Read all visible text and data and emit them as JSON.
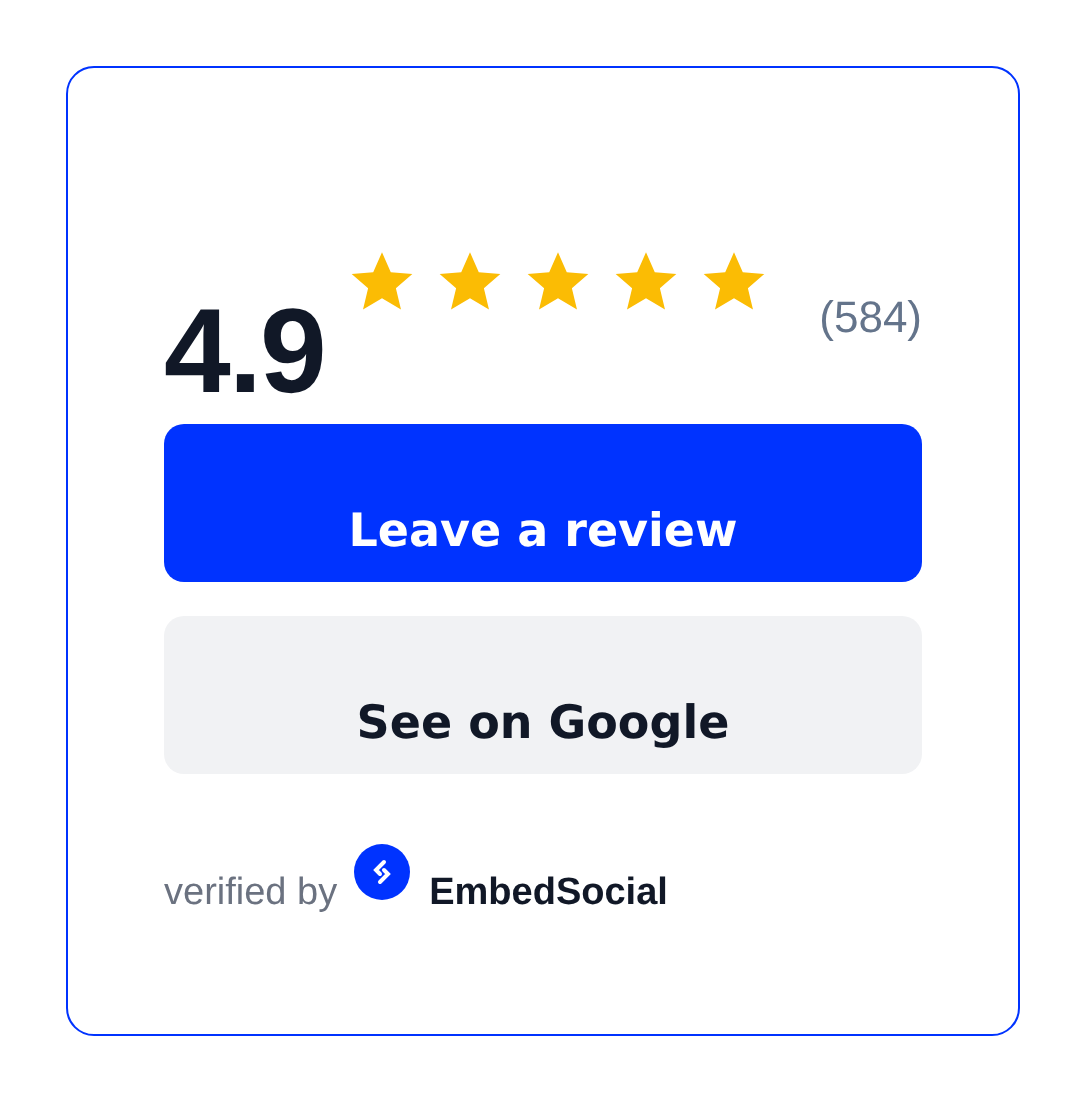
{
  "rating": {
    "score": "4.9",
    "stars": 5,
    "count": "(584)"
  },
  "buttons": [
    {
      "label": "Leave a review",
      "kind": "primary"
    },
    {
      "label": "See on Google",
      "kind": "secondary"
    }
  ],
  "footer": {
    "prefix": "verified by",
    "brand": "EmbedSocial"
  }
}
